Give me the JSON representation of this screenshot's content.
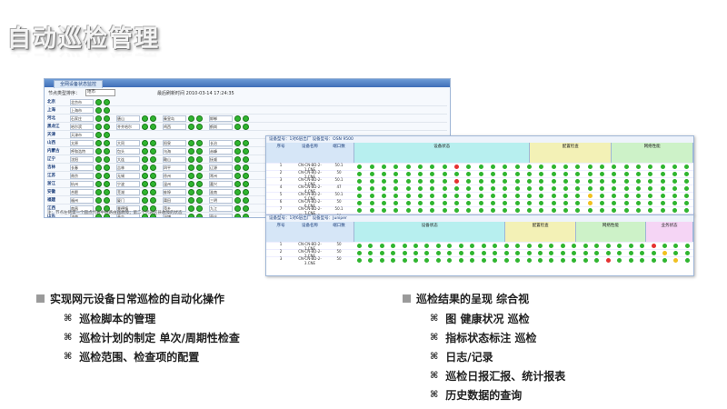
{
  "title": "自动巡检管理",
  "panel": {
    "tab": "全网设备状态监控",
    "filter_label": "节点类型排序：",
    "filter_value": "地市",
    "refresh_label": "最后刷新时间 2010-03-14 17:24:35",
    "rows": [
      {
        "name": "北京",
        "cells": [
          "北京市",
          "",
          "",
          ""
        ]
      },
      {
        "name": "上海",
        "cells": [
          "上海市",
          "",
          "",
          ""
        ]
      },
      {
        "name": "河北",
        "cells": [
          "石家庄",
          "唐山",
          "秦皇岛",
          "邯郸"
        ]
      },
      {
        "name": "黑龙江",
        "cells": [
          "哈尔滨",
          "齐齐哈尔",
          "鸡西",
          "鹤岗"
        ]
      },
      {
        "name": "天津",
        "cells": [
          "天津市",
          "",
          "",
          ""
        ]
      },
      {
        "name": "山西",
        "cells": [
          "太原",
          "大同",
          "阳泉",
          "长治"
        ]
      },
      {
        "name": "内蒙古",
        "cells": [
          "呼和浩特",
          "包头",
          "乌海",
          "赤峰"
        ]
      },
      {
        "name": "辽宁",
        "cells": [
          "沈阳",
          "大连",
          "鞍山",
          "抚顺"
        ]
      },
      {
        "name": "吉林",
        "cells": [
          "长春",
          "吉林",
          "四平",
          "辽源"
        ]
      },
      {
        "name": "江苏",
        "cells": [
          "南京",
          "无锡",
          "徐州",
          "常州"
        ]
      },
      {
        "name": "浙江",
        "cells": [
          "杭州",
          "宁波",
          "温州",
          "嘉兴"
        ]
      },
      {
        "name": "安徽",
        "cells": [
          "合肥",
          "芜湖",
          "蚌埠",
          "淮南"
        ]
      },
      {
        "name": "福建",
        "cells": [
          "福州",
          "厦门",
          "莆田",
          "三明"
        ]
      },
      {
        "name": "江西",
        "cells": [
          "南昌",
          "景德镇",
          "萍乡",
          "九江"
        ]
      },
      {
        "name": "山东",
        "cells": [
          "济南",
          "青岛",
          "淄博",
          "枣庄"
        ]
      },
      {
        "name": "宁夏",
        "cells": [
          "银川",
          "",
          "",
          ""
        ]
      },
      {
        "name": "新疆",
        "cells": [
          "乌鲁木齐",
          "克拉玛依",
          "吐鲁番",
          "哈密"
        ]
      },
      {
        "name": "海外POP点",
        "cells": [
          "伦敦",
          "纽约",
          "东京",
          "悉尼"
        ]
      }
    ],
    "footer": "注：节点左侧第一个圆点代表中继路由器故障；第二个代表区县故障的状态"
  },
  "grid1": {
    "caption": "设备型号：1对6层出厂  设备型号：OSN 9500",
    "col_heads": [
      "序号",
      "设备名称",
      "端口数"
    ],
    "groups": [
      "设备状态",
      "配置检查",
      "网络性能"
    ],
    "rows": [
      {
        "id": "1",
        "name": "CN-CN-BD-2-1.CNE",
        "n": "50.1"
      },
      {
        "id": "2",
        "name": "CN-CN-BD-2-2.CNE",
        "n": "50"
      },
      {
        "id": "3",
        "name": "CN-CN-BD-2-3.CNE",
        "n": "50.1"
      },
      {
        "id": "4",
        "name": "CN-CN-BD-2-4.CNE",
        "n": "47"
      },
      {
        "id": "5",
        "name": "CN-CN-BD-2-5.CNE",
        "n": "50.1"
      },
      {
        "id": "6",
        "name": "CN-CN-BD-2-6.CNE",
        "n": "50"
      },
      {
        "id": "7",
        "name": "CN-CN-BD-2-7.CNE",
        "n": "50.1"
      },
      {
        "id": "8",
        "name": "CN-CN-BD-2-8.CNE",
        "n": "50"
      }
    ]
  },
  "grid2": {
    "caption": "设备型号：1对6层出厂  设备型号：Juniper",
    "col_heads": [
      "序号",
      "设备名称",
      "端口数"
    ],
    "groups": [
      "设备状态",
      "配置检查",
      "网络性能",
      "业务状态"
    ],
    "rows": [
      {
        "id": "1",
        "name": "CN-CN-BD-2-1.CNE",
        "n": "50"
      },
      {
        "id": "2",
        "name": "CN-CN-BD-2-2.CNE",
        "n": "50"
      },
      {
        "id": "3",
        "name": "CN-CN-BD-2-3.CNE",
        "n": "50"
      }
    ]
  },
  "left_bullets": {
    "heading": "实现网元设备日常巡检的自动化操作",
    "items": [
      "巡检脚本的管理",
      "巡检计划的制定 单次/周期性检查",
      "巡检范围、检查项的配置"
    ]
  },
  "right_bullets": {
    "heading": "巡检结果的呈现 综合视",
    "items": [
      "图 健康状况 巡检",
      "指标状态标注 巡检",
      "日志/记录",
      "巡检日报汇报、统计报表",
      "历史数据的查询"
    ]
  },
  "colors": {
    "ok": "#2fb52f",
    "alarm": "#e53131",
    "warn": "#f0c020",
    "accent": "#3f6fb8"
  }
}
